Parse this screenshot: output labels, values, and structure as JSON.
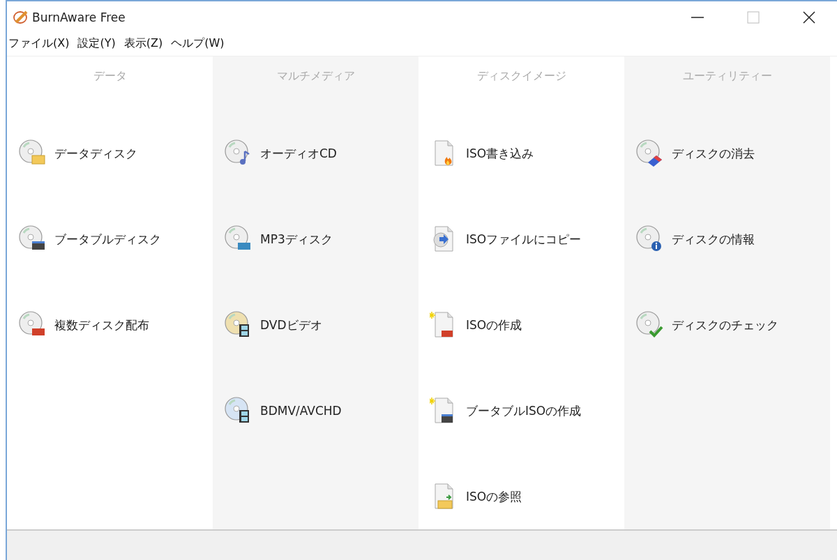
{
  "window": {
    "title": "BurnAware Free"
  },
  "menu": [
    "ファイル(X)",
    "設定(Y)",
    "表示(Z)",
    "ヘルプ(W)"
  ],
  "columns": [
    {
      "header": "データ",
      "items": [
        {
          "label": "データディスク",
          "kind": "folder"
        },
        {
          "label": "ブータブルディスク",
          "kind": "boot"
        },
        {
          "label": "複数ディスク配布",
          "kind": "multi"
        }
      ]
    },
    {
      "header": "マルチメディア",
      "items": [
        {
          "label": "オーディオCD",
          "kind": "audio"
        },
        {
          "label": "MP3ディスク",
          "kind": "mp3"
        },
        {
          "label": "DVDビデオ",
          "kind": "dvd"
        },
        {
          "label": "BDMV/AVCHD",
          "kind": "bluray"
        }
      ]
    },
    {
      "header": "ディスクイメージ",
      "items": [
        {
          "label": "ISO書き込み",
          "kind": "burn"
        },
        {
          "label": "ISOファイルにコピー",
          "kind": "copy"
        },
        {
          "label": "ISOの作成",
          "kind": "isocreate"
        },
        {
          "label": "ブータブルISOの作成",
          "kind": "bootiso"
        },
        {
          "label": "ISOの参照",
          "kind": "browse"
        }
      ]
    },
    {
      "header": "ユーティリティー",
      "items": [
        {
          "label": "ディスクの消去",
          "kind": "erase"
        },
        {
          "label": "ディスクの情報",
          "kind": "info"
        },
        {
          "label": "ディスクのチェック",
          "kind": "check"
        }
      ]
    }
  ]
}
